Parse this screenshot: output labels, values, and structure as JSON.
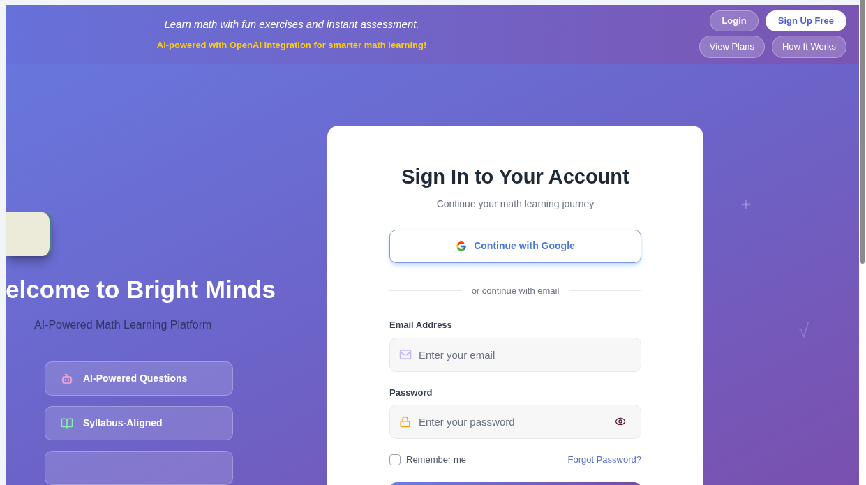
{
  "header": {
    "tagline": "Learn math with fun exercises and instant assessment.",
    "highlight": "AI-powered with OpenAI integration for smarter math learning!",
    "top_buttons": [
      {
        "label": "Login",
        "kind": "outline"
      },
      {
        "label": "Sign Up Free",
        "kind": "solid"
      }
    ],
    "nav_buttons": [
      "View Plans",
      "How It Works"
    ]
  },
  "hero": {
    "title": "elcome to Bright Minds",
    "subtitle": "AI-Powered Math Learning Platform",
    "features": [
      {
        "label": "AI-Powered Questions",
        "kind": "robot"
      },
      {
        "label": "Syllabus-Aligned",
        "kind": "books"
      }
    ]
  },
  "login": {
    "title": "Sign In to Your Account",
    "subtitle": "Continue your math learning journey",
    "google_button": "Continue with Google",
    "divider": "or continue with email",
    "email": {
      "label": "Email Address",
      "placeholder": "Enter your email"
    },
    "password": {
      "label": "Password",
      "placeholder": "Enter your password"
    },
    "remember": {
      "label": "Remember me",
      "checked": false
    },
    "forgot_link": "Forgot Password?"
  },
  "decorations": [
    "√"
  ]
}
